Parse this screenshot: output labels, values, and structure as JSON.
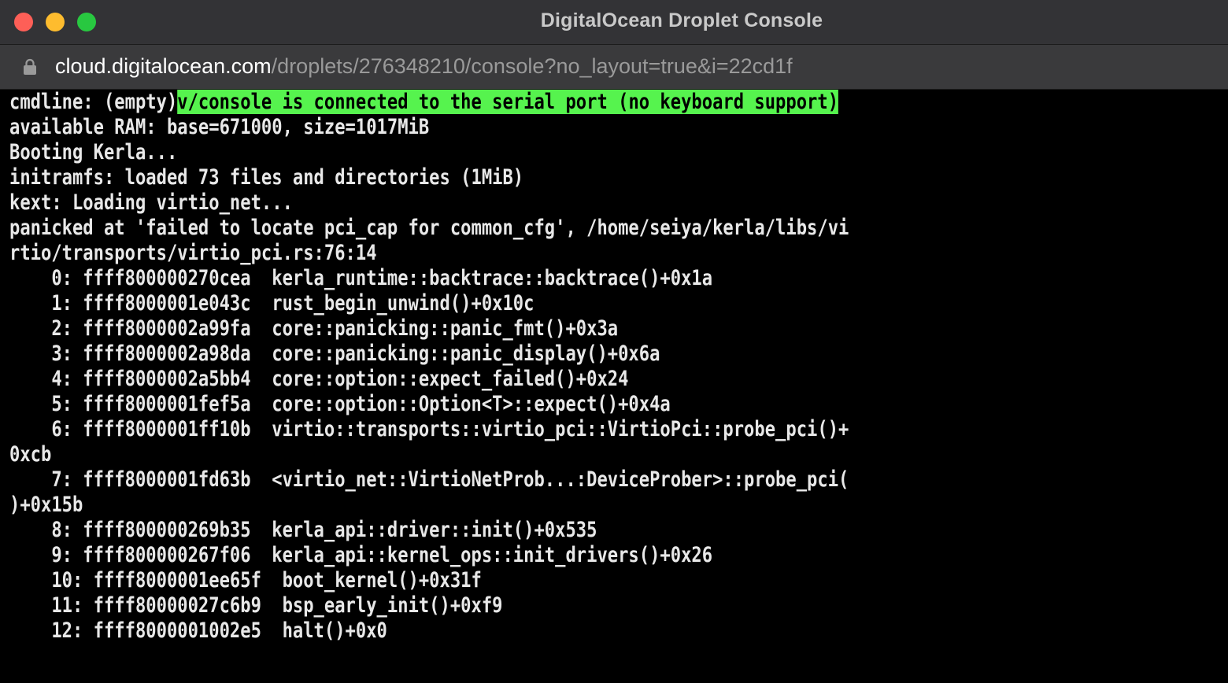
{
  "window": {
    "title": "DigitalOcean Droplet Console"
  },
  "address_bar": {
    "url_host": "cloud.digitalocean.com",
    "url_path": "/droplets/276348210/console?no_layout=true&i=22cd1f"
  },
  "console": {
    "first_line_prefix": "cmdline: (empty)",
    "first_line_highlight": "v/console is connected to the serial port (no keyboard support)",
    "lines": [
      "available RAM: base=671000, size=1017MiB",
      "Booting Kerla...",
      "initramfs: loaded 73 files and directories (1MiB)",
      "kext: Loading virtio_net...",
      "panicked at 'failed to locate pci_cap for common_cfg', /home/seiya/kerla/libs/vi",
      "rtio/transports/virtio_pci.rs:76:14",
      "    0: ffff800000270cea  kerla_runtime::backtrace::backtrace()+0x1a",
      "    1: ffff8000001e043c  rust_begin_unwind()+0x10c",
      "    2: ffff8000002a99fa  core::panicking::panic_fmt()+0x3a",
      "    3: ffff8000002a98da  core::panicking::panic_display()+0x6a",
      "    4: ffff8000002a5bb4  core::option::expect_failed()+0x24",
      "    5: ffff8000001fef5a  core::option::Option<T>::expect()+0x4a",
      "    6: ffff8000001ff10b  virtio::transports::virtio_pci::VirtioPci::probe_pci()+",
      "0xcb",
      "    7: ffff8000001fd63b  <virtio_net::VirtioNetProb...:DeviceProber>::probe_pci(",
      ")+0x15b",
      "    8: ffff800000269b35  kerla_api::driver::init()+0x535",
      "    9: ffff800000267f06  kerla_api::kernel_ops::init_drivers()+0x26",
      "    10: ffff8000001ee65f  boot_kernel()+0x31f",
      "    11: ffff80000027c6b9  bsp_early_init()+0xf9",
      "    12: ffff8000001002e5  halt()+0x0"
    ]
  },
  "colors": {
    "highlight": "#56f34e",
    "close": "#fe5f57",
    "minimize": "#febc2e",
    "maximize": "#28c840"
  }
}
